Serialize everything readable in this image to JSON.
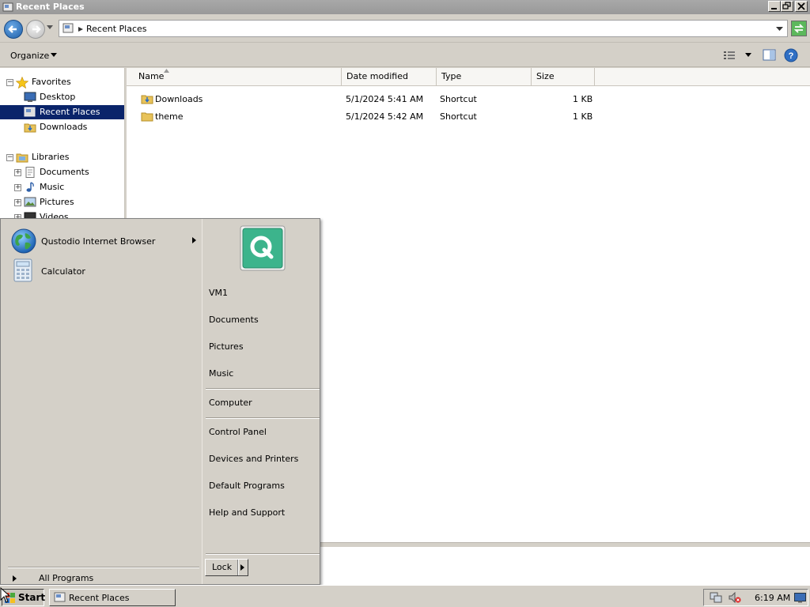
{
  "window": {
    "title": "Recent Places",
    "address": {
      "breadcrumb": "Recent Places"
    }
  },
  "command_bar": {
    "organize_label": "Organize"
  },
  "nav_pane": {
    "favorites_label": "Favorites",
    "favorites": [
      {
        "label": "Desktop"
      },
      {
        "label": "Recent Places",
        "selected": true
      },
      {
        "label": "Downloads"
      }
    ],
    "libraries_label": "Libraries",
    "libraries": [
      {
        "label": "Documents"
      },
      {
        "label": "Music"
      },
      {
        "label": "Pictures"
      },
      {
        "label": "Videos"
      }
    ]
  },
  "file_list": {
    "columns": [
      "Name",
      "Date modified",
      "Type",
      "Size"
    ],
    "rows": [
      {
        "name": "Downloads",
        "date_modified": "5/1/2024 5:41 AM",
        "type": "Shortcut",
        "size": "1 KB"
      },
      {
        "name": "theme",
        "date_modified": "5/1/2024 5:42 AM",
        "type": "Shortcut",
        "size": "1 KB"
      }
    ]
  },
  "start_menu": {
    "programs": [
      {
        "label": "Qustodio Internet Browser",
        "has_submenu": true,
        "icon": "globe-icon"
      },
      {
        "label": "Calculator",
        "has_submenu": false,
        "icon": "calculator-icon"
      }
    ],
    "all_programs_label": "All Programs",
    "user_tile_icon": "qustodio-q-icon",
    "right_links_group1": [
      "VM1",
      "Documents",
      "Pictures",
      "Music"
    ],
    "right_links_group2": [
      "Computer"
    ],
    "right_links_group3": [
      "Control Panel",
      "Devices and Printers",
      "Default Programs",
      "Help and Support"
    ],
    "lock_label": "Lock"
  },
  "taskbar": {
    "start_label": "Start",
    "task_button_label": "Recent Places",
    "clock": "6:19 AM"
  },
  "colors": {
    "selection": "#0a246a",
    "classic_face": "#d4d0c8",
    "qustodio_green": "#3cb48c"
  }
}
